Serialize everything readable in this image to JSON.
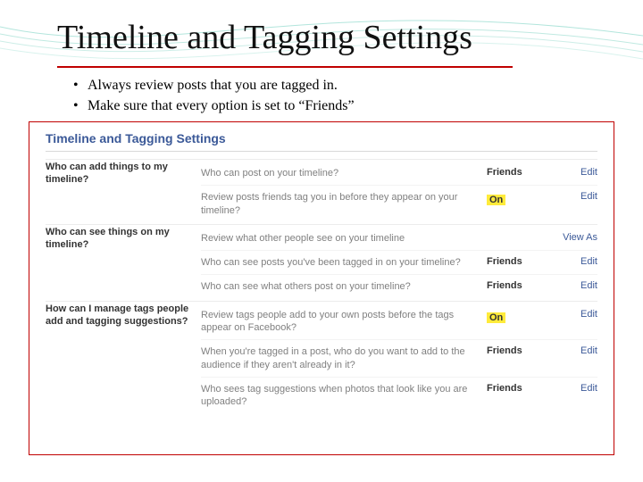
{
  "slide": {
    "title": "Timeline and Tagging Settings",
    "bullets": [
      "Always review posts that you are tagged in.",
      "Make sure that every option is set to “Friends”"
    ]
  },
  "panel": {
    "heading": "Timeline and Tagging Settings",
    "sections": [
      {
        "question": "Who can add things to my timeline?",
        "rows": [
          {
            "desc": "Who can post on your timeline?",
            "value": "Friends",
            "highlight": false,
            "action": "Edit"
          },
          {
            "desc": "Review posts friends tag you in before they appear on your timeline?",
            "value": "On",
            "highlight": true,
            "action": "Edit"
          }
        ]
      },
      {
        "question": "Who can see things on my timeline?",
        "rows": [
          {
            "desc": "Review what other people see on your timeline",
            "value": "",
            "highlight": false,
            "action": "View As"
          },
          {
            "desc": "Who can see posts you've been tagged in on your timeline?",
            "value": "Friends",
            "highlight": false,
            "action": "Edit"
          },
          {
            "desc": "Who can see what others post on your timeline?",
            "value": "Friends",
            "highlight": false,
            "action": "Edit"
          }
        ]
      },
      {
        "question": "How can I manage tags people add and tagging suggestions?",
        "rows": [
          {
            "desc": "Review tags people add to your own posts before the tags appear on Facebook?",
            "value": "On",
            "highlight": true,
            "action": "Edit"
          },
          {
            "desc": "When you're tagged in a post, who do you want to add to the audience if they aren't already in it?",
            "value": "Friends",
            "highlight": false,
            "action": "Edit"
          },
          {
            "desc": "Who sees tag suggestions when photos that look like you are uploaded?",
            "value": "Friends",
            "highlight": false,
            "action": "Edit"
          }
        ]
      }
    ]
  }
}
